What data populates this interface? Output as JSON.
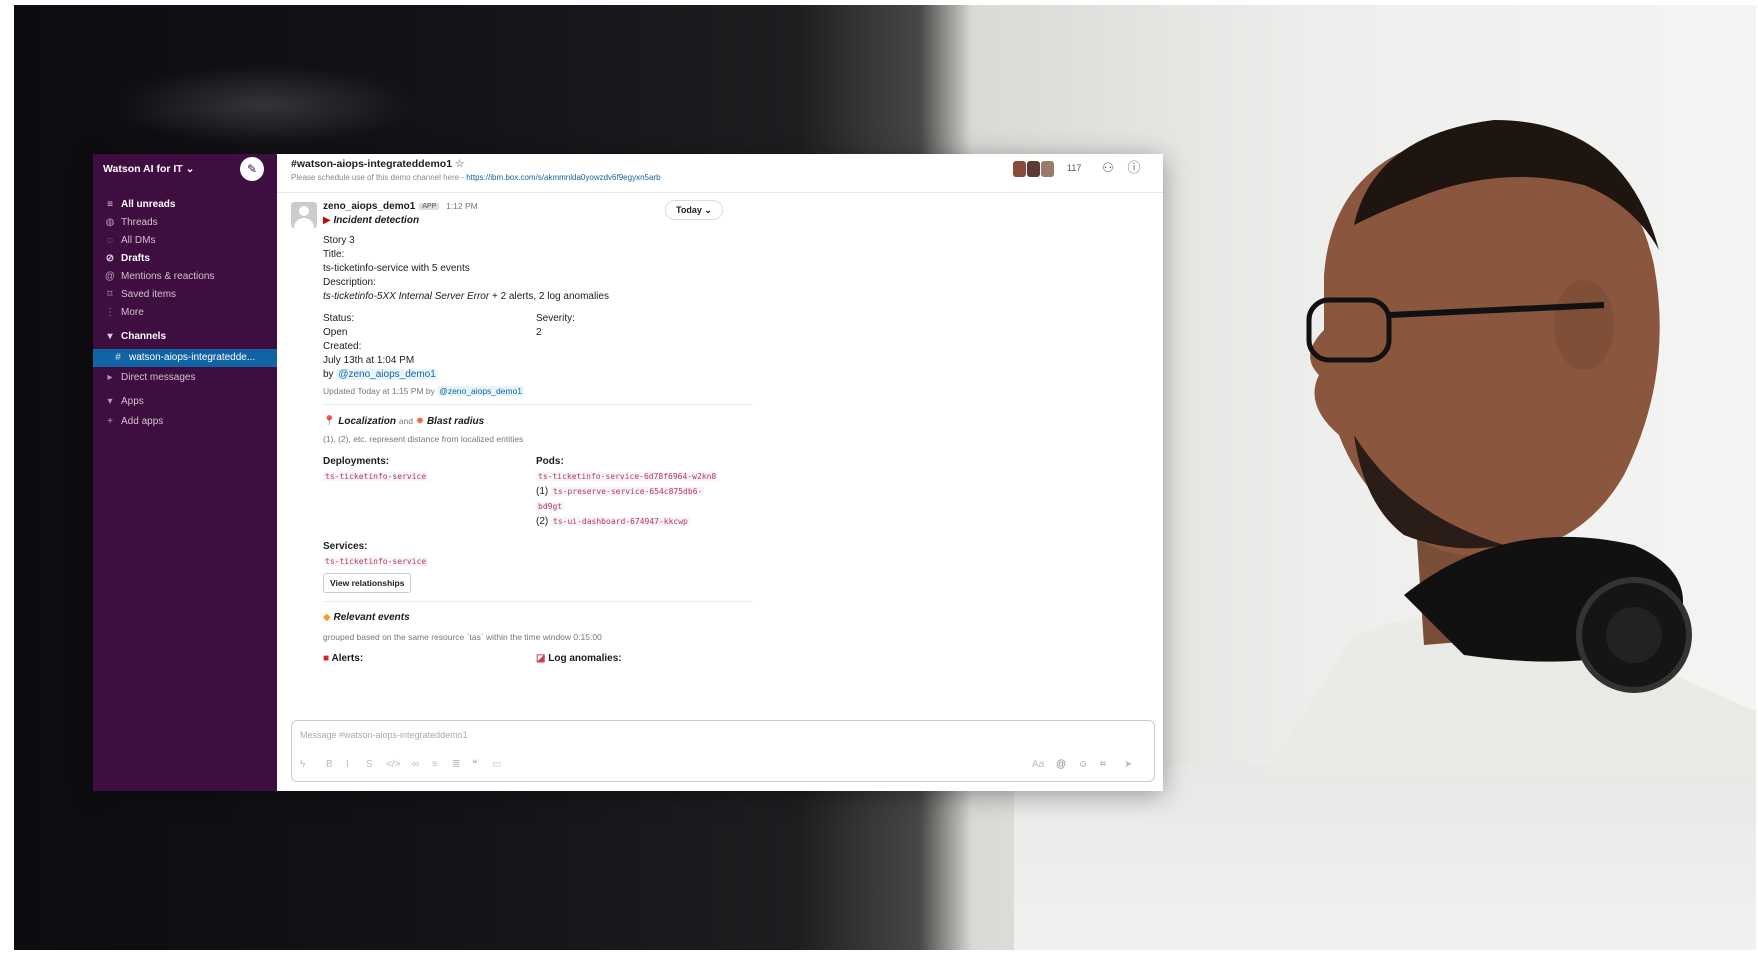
{
  "sidebar": {
    "workspace": "Watson AI for IT",
    "items": [
      {
        "label": "All unreads",
        "icon": "unreads-icon",
        "bold": true
      },
      {
        "label": "Threads",
        "icon": "threads-icon",
        "bold": false
      },
      {
        "label": "All DMs",
        "icon": "dms-icon",
        "bold": false
      },
      {
        "label": "Drafts",
        "icon": "drafts-icon",
        "bold": true
      },
      {
        "label": "Mentions & reactions",
        "icon": "mentions-icon",
        "bold": false
      },
      {
        "label": "Saved items",
        "icon": "bookmark-icon",
        "bold": false
      },
      {
        "label": "More",
        "icon": "more-icon",
        "bold": false
      }
    ],
    "channels_label": "Channels",
    "active_channel": "watson-aiops-integratedde...",
    "dms_label": "Direct messages",
    "apps_label": "Apps",
    "add_apps": "Add apps"
  },
  "header": {
    "channel": "#watson-aiops-integrateddemo1",
    "description": "Please schedule use of this demo channel here - ",
    "link": "https://ibm.box.com/s/akmmnlda0yowzdv6f9egyxn5arb",
    "member_count": "117"
  },
  "message": {
    "author": "zeno_aiops_demo1",
    "badge": "APP",
    "time": "1:12 PM",
    "today": "Today",
    "incident_title": "Incident detection",
    "story": "Story 3",
    "title_label": "Title:",
    "title_value": "ts-ticketinfo-service with 5 events",
    "desc_label": "Description:",
    "desc_value_italic": "ts-ticketinfo-5XX Internal Server Error",
    "desc_value_rest": " + 2 alerts, 2 log anomalies",
    "status_label": "Status:",
    "status_value": "Open",
    "severity_label": "Severity:",
    "severity_value": "2",
    "created_label": "Created:",
    "created_value": "July 13th at 1:04 PM",
    "by": "by ",
    "by_user": "@zeno_aiops_demo1",
    "updated": "Updated Today at 1:15 PM by ",
    "updated_user": "@zeno_aiops_demo1",
    "localization": "Localization",
    "and": "and",
    "blast": "Blast radius",
    "loc_note": "(1), (2), etc. represent distance from localized entities",
    "deployments_label": "Deployments:",
    "deployment": "ts-ticketinfo-service",
    "pods_label": "Pods:",
    "pod0": "ts-ticketinfo-service-6d78f6964-w2kn8",
    "pod1_prefix": "(1)",
    "pod1a": "ts-preserve-service-654c875db6-",
    "pod1b": "bd9gt",
    "pod2_prefix": "(2)",
    "pod2": "ts-ui-dashboard-674947-kkcwp",
    "services_label": "Services:",
    "service": "ts-ticketinfo-service",
    "view_rel": "View relationships",
    "relevant": "Relevant events",
    "grouped_note": "grouped based on the same resource `tas` within the time window 0:15:00",
    "alerts_label": "Alerts:",
    "log_label": "Log anomalies:"
  },
  "composer": {
    "placeholder": "Message #watson-aiops-integrateddemo1"
  },
  "colors": {
    "sidebar": "#3f0e40",
    "active": "#1164a3",
    "link": "#1264a3",
    "code": "#c0325a"
  }
}
